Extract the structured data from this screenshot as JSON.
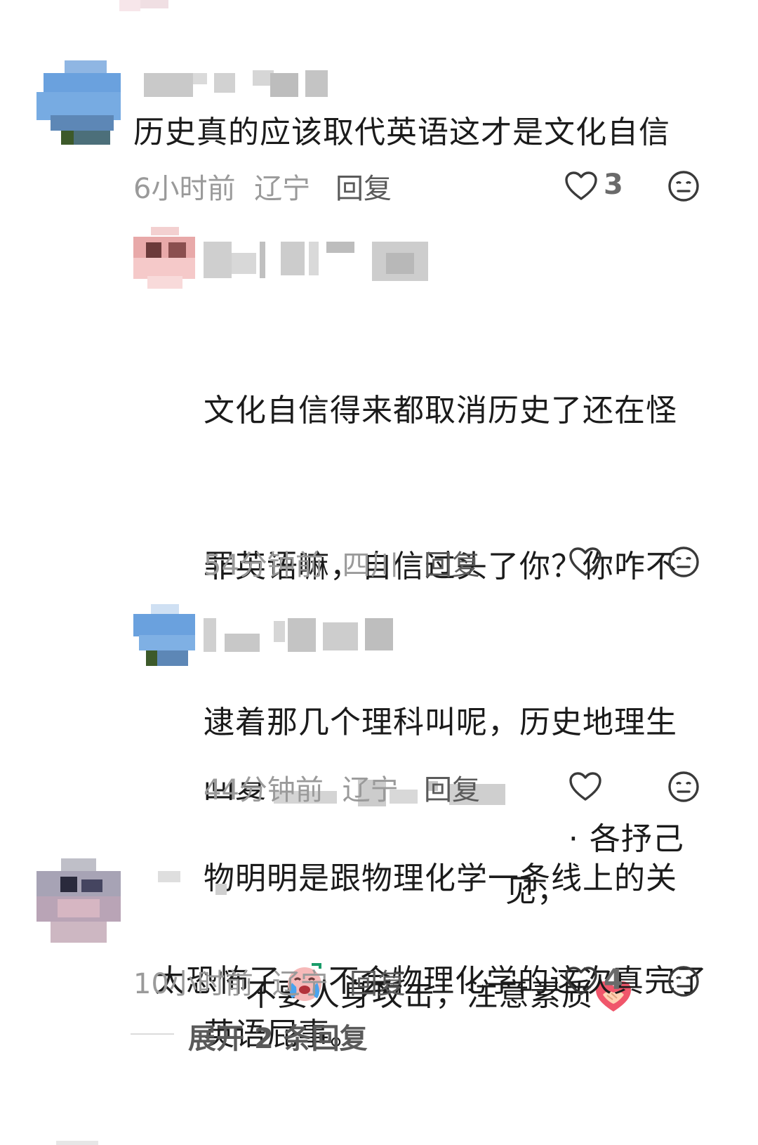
{
  "comments": [
    {
      "text": "历史真的应该取代英语这才是文化自信",
      "time": "6小时前",
      "location": "辽宁",
      "reply_label": "回复",
      "likes": "3",
      "replies": [
        {
          "text_lines": [
            "文化自信得来都取消历史了还在怪",
            "罪英语嘛，自信过头了你？你咋不",
            "逮着那几个理科叫呢，历史地理生",
            "物明明是跟物理化学一条线上的关",
            "英语屁事。"
          ],
          "time": "54分钟前",
          "location": "四川",
          "reply_label": "回复"
        },
        {
          "prefix_label": "回复",
          "text_line1_tail": "各抒己见，",
          "text_line2": "不要人身攻击，注意素质",
          "time": "44分钟前",
          "location": "辽宁",
          "reply_label": "回复"
        }
      ]
    },
    {
      "text_before_emoji": "太恐怖了",
      "text_after_emoji": "不会物理化学的这次真完了",
      "time": "10小时前",
      "location": "辽宁",
      "reply_label": "回复",
      "likes": "4",
      "expand_label": "展开 2 条回复"
    }
  ],
  "icons": {
    "like": "heart-outline-icon",
    "dislike": "meh-face-icon",
    "handshake": "handshake-emoji-icon",
    "crying": "crying-face-emoji-icon"
  },
  "colors": {
    "meta": "#9a9a9a",
    "text": "#1b1b1b",
    "icon": "#3a3a3a"
  }
}
